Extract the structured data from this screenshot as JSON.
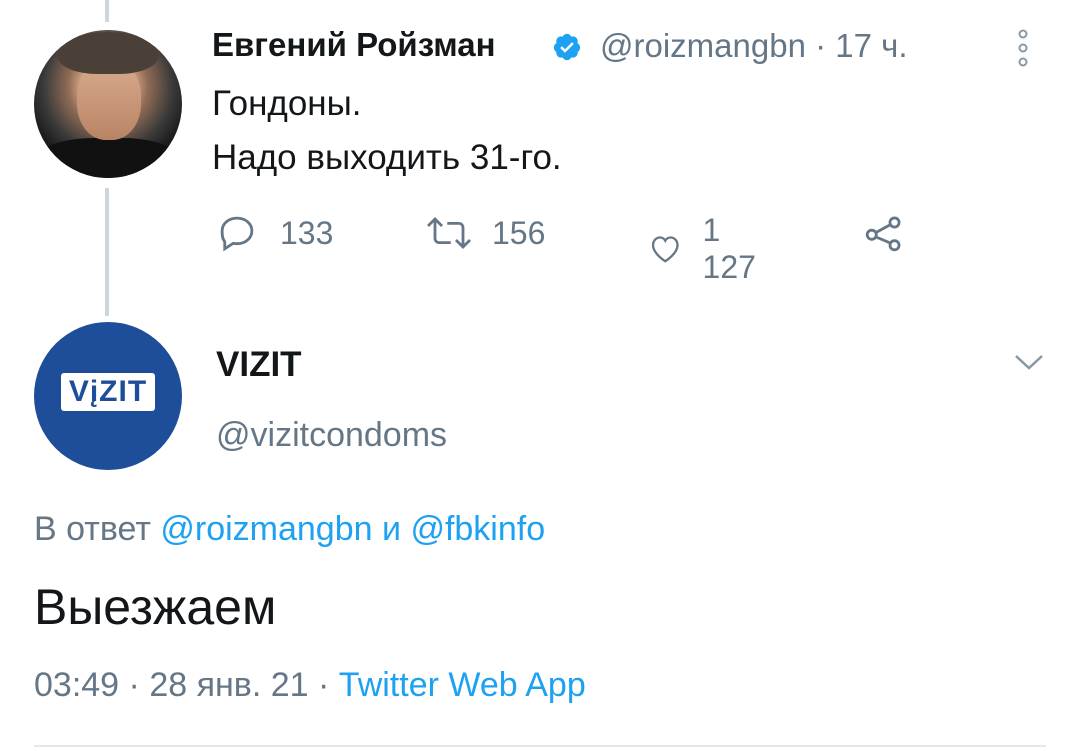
{
  "parent_tweet": {
    "author_name": "Евгений Ройзман",
    "handle": "@roizmangbn",
    "separator": "·",
    "time_ago": "17 ч.",
    "text_lines": [
      "Гондоны.",
      "Надо выходить 31-го."
    ],
    "actions": {
      "replies": "133",
      "retweets": "156",
      "likes": "1 127"
    }
  },
  "reply_tweet": {
    "author_name": "VIZIT",
    "handle": "@vizitcondoms",
    "avatar_logo_text": "VįZIT",
    "reply_prefix": "В ответ",
    "reply_handle_1": "@roizmangbn",
    "reply_joiner": "и",
    "reply_handle_2": "@fbkinfo",
    "text": "Выезжаем",
    "time": "03:49",
    "date": "28 янв. 21",
    "source": "Twitter Web App",
    "separator": "·"
  },
  "colors": {
    "link": "#1da1f2",
    "muted": "#657786",
    "text": "#14171a",
    "vizit_blue": "#1e4e9a",
    "thread_line": "#ccd6dd"
  },
  "icons": [
    "verified-badge-icon",
    "more-vertical-icon",
    "reply-icon",
    "retweet-icon",
    "like-icon",
    "share-icon",
    "chevron-down-icon"
  ]
}
